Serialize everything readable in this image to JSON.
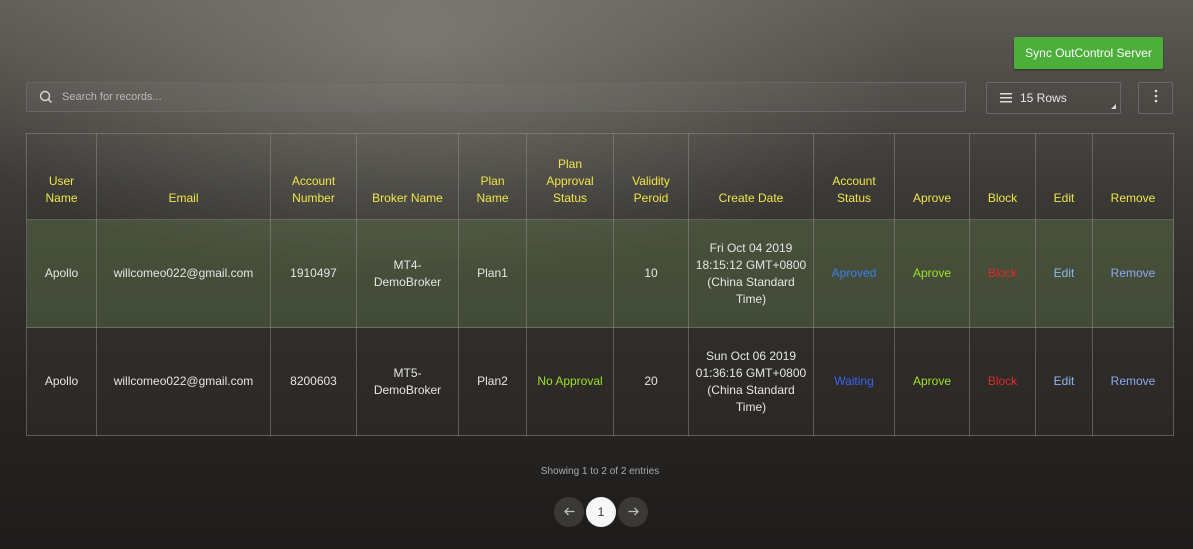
{
  "toolbar": {
    "sync_label": "Sync OutControl Server",
    "search_placeholder": "Search for records...",
    "rows_label": "15 Rows"
  },
  "table": {
    "headers": {
      "user_name": "User Name",
      "email": "Email",
      "account_number": "Account Number",
      "broker_name": "Broker Name",
      "plan_name": "Plan Name",
      "plan_approval_status": "Plan Approval Status",
      "validity_period": "Validity Peroid",
      "create_date": "Create Date",
      "account_status": "Account Status",
      "approve": "Aprove",
      "block": "Block",
      "edit": "Edit",
      "remove": "Remove"
    },
    "rows": [
      {
        "user_name": "Apollo",
        "email": "willcomeo022@gmail.com",
        "account_number": "1910497",
        "broker_name": "MT4-DemoBroker",
        "plan_name": "Plan1",
        "plan_approval_status": "",
        "validity_period": "10",
        "create_date": "Fri Oct 04 2019 18:15:12 GMT+0800 (China Standard Time)",
        "account_status": "Aproved",
        "approve": "Aprove",
        "block": "Block",
        "edit": "Edit",
        "remove": "Remove"
      },
      {
        "user_name": "Apollo",
        "email": "willcomeo022@gmail.com",
        "account_number": "8200603",
        "broker_name": "MT5-DemoBroker",
        "plan_name": "Plan2",
        "plan_approval_status": "No Approval",
        "validity_period": "20",
        "create_date": "Sun Oct 06 2019 01:36:16 GMT+0800 (China Standard Time)",
        "account_status": "Waiting",
        "approve": "Aprove",
        "block": "Block",
        "edit": "Edit",
        "remove": "Remove"
      }
    ]
  },
  "footer": {
    "info": "Showing 1 to 2 of 2 entries",
    "current_page": "1",
    "prev_icon": "arrow-left-icon",
    "next_icon": "arrow-right-icon"
  },
  "colors": {
    "sync_button": "#4caf3a",
    "header_text": "#f0e64a",
    "approved": "#3b7ff0",
    "waiting": "#3b62f0",
    "approve_link": "#9be22a",
    "block_link": "#e02a2a",
    "edit_link": "#8fb8f2"
  }
}
